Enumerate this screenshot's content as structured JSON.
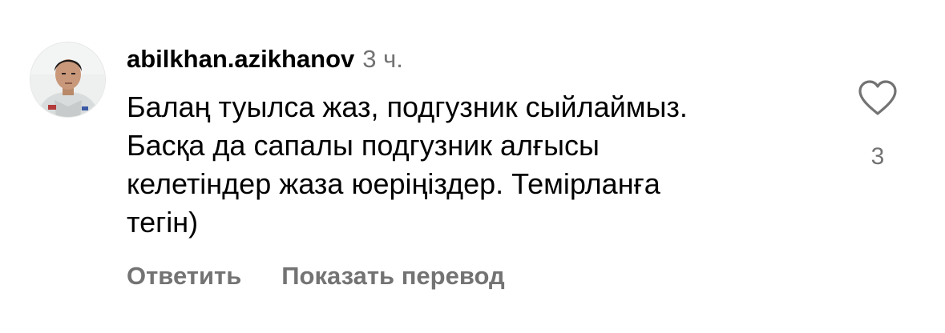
{
  "comment": {
    "username": "abilkhan.azikhanov",
    "timestamp": "3 ч.",
    "text_lines": [
      "Балаң туылса жаз, подгузник сыйлаймыз.",
      "Басқа да сапалы подгузник алғысы",
      "келетіндер жаза юеріңіздер. Темірланға",
      "тегін)"
    ],
    "reply_label": "Ответить",
    "translate_label": "Показать перевод",
    "like_count": "3",
    "like_icon": "heart-outline-icon"
  },
  "colors": {
    "text_primary": "#000000",
    "text_secondary": "#737373",
    "background": "#ffffff"
  }
}
